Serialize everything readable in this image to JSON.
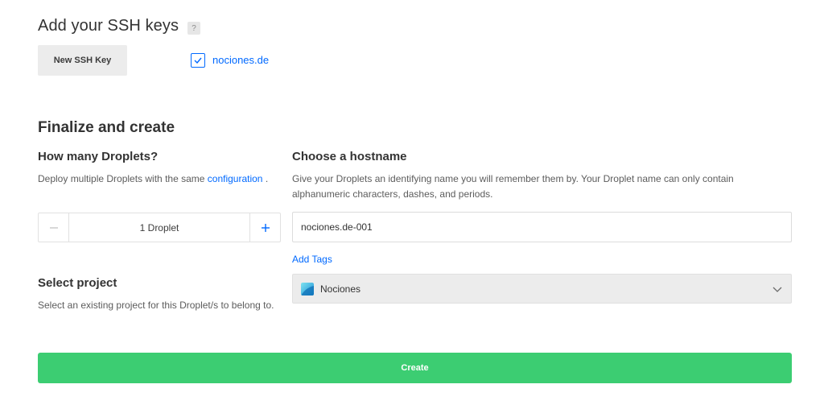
{
  "ssh": {
    "title": "Add your SSH keys",
    "help_badge": "?",
    "new_key_button": "New SSH Key",
    "keys": [
      {
        "label": "nociones.de",
        "checked": true
      }
    ]
  },
  "finalize": {
    "title": "Finalize and create",
    "droplets": {
      "heading": "How many Droplets?",
      "description_prefix": "Deploy multiple Droplets with the same",
      "description_link": "configuration",
      "description_suffix": ".",
      "count_display": "1  Droplet",
      "minus_icon": "minus-icon",
      "plus_icon": "plus-icon"
    },
    "hostname": {
      "heading": "Choose a hostname",
      "description": "Give your Droplets an identifying name you will remember them by. Your Droplet name can only contain alphanumeric characters, dashes, and periods.",
      "value": "nociones.de-001",
      "add_tags": "Add Tags"
    },
    "project": {
      "heading": "Select project",
      "description": "Select an existing project for this Droplet/s to belong to.",
      "selected": "Nociones",
      "icon": "project-icon"
    },
    "create_button": "Create"
  },
  "colors": {
    "accent": "#0069ff",
    "create": "#3ccd72"
  }
}
